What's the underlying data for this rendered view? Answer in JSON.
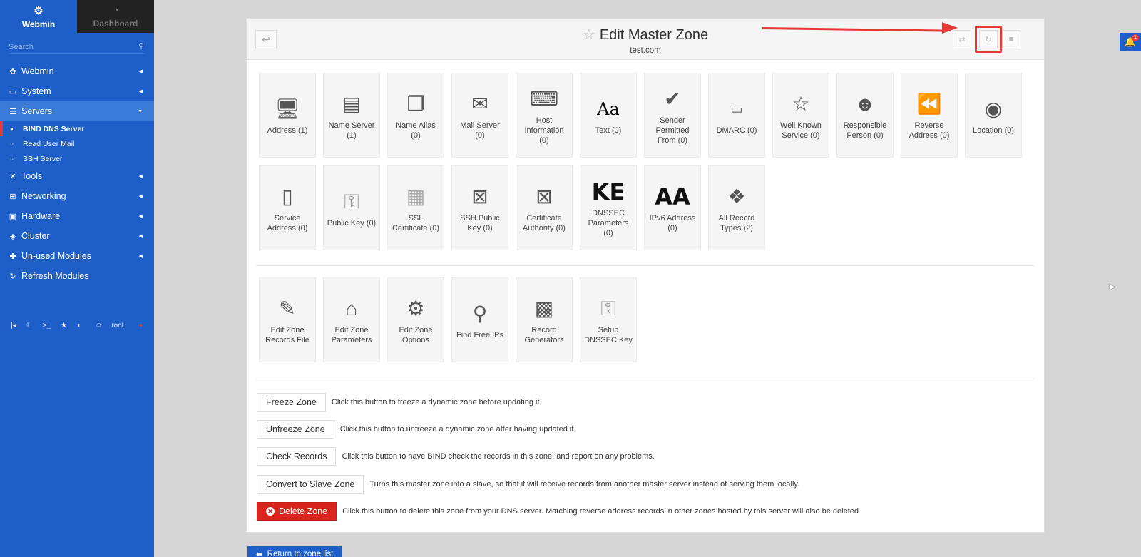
{
  "sidebar": {
    "tab_webmin": "Webmin",
    "tab_dashboard": "Dashboard",
    "search_placeholder": "Search",
    "menu": {
      "webmin": "Webmin",
      "system": "System",
      "servers": "Servers",
      "bind": "BIND DNS Server",
      "readmail": "Read User Mail",
      "ssh": "SSH Server",
      "tools": "Tools",
      "networking": "Networking",
      "hardware": "Hardware",
      "cluster": "Cluster",
      "unused": "Un-used Modules",
      "refresh": "Refresh Modules"
    },
    "user": "root"
  },
  "header": {
    "title": "Edit Master Zone",
    "zone": "test.com"
  },
  "record_types": [
    {
      "label": "Address (1)",
      "icon": "monitor-icon"
    },
    {
      "label": "Name Server (1)",
      "icon": "id-card-icon"
    },
    {
      "label": "Name Alias (0)",
      "icon": "windows-icon"
    },
    {
      "label": "Mail Server (0)",
      "icon": "mailbox-icon"
    },
    {
      "label": "Host Information (0)",
      "icon": "laptop-icon"
    },
    {
      "label": "Text (0)",
      "icon": "text-aa-icon",
      "glyph": "Aa"
    },
    {
      "label": "Sender Permitted From (0)",
      "icon": "envelope-check-icon"
    },
    {
      "label": "DMARC (0)",
      "icon": "dmarc-icon"
    },
    {
      "label": "Well Known Service (0)",
      "icon": "star-icon"
    },
    {
      "label": "Responsible Person (0)",
      "icon": "person-icon"
    },
    {
      "label": "Reverse Address (0)",
      "icon": "rewind-icon"
    },
    {
      "label": "Location (0)",
      "icon": "globe-icon"
    },
    {
      "label": "Service Address (0)",
      "icon": "server-icon"
    },
    {
      "label": "Public Key (0)",
      "icon": "key-icon"
    },
    {
      "label": "SSL Certificate (0)",
      "icon": "certificate-icon"
    },
    {
      "label": "SSH Public Key (0)",
      "icon": "ssh-window-icon"
    },
    {
      "label": "Certificate Authority (0)",
      "icon": "ca-window-icon"
    },
    {
      "label": "DNSSEC Parameters (0)",
      "icon": "ke-icon",
      "glyph": "KE"
    },
    {
      "label": "IPv6 Address (0)",
      "icon": "aa-icon",
      "glyph": "AA"
    },
    {
      "label": "All Record Types (2)",
      "icon": "cubes-icon"
    }
  ],
  "zone_tools": [
    {
      "label": "Edit Zone Records File",
      "icon": "file-edit-icon"
    },
    {
      "label": "Edit Zone Parameters",
      "icon": "lamp-icon"
    },
    {
      "label": "Edit Zone Options",
      "icon": "gear-icon"
    },
    {
      "label": "Find Free IPs",
      "icon": "magnifier-icon"
    },
    {
      "label": "Record Generators",
      "icon": "generator-icon"
    },
    {
      "label": "Setup DNSSEC Key",
      "icon": "key-icon"
    }
  ],
  "actions": [
    {
      "button": "Freeze Zone",
      "desc": "Click this button to freeze a dynamic zone before updating it."
    },
    {
      "button": "Unfreeze Zone",
      "desc": "Click this button to unfreeze a dynamic zone after having updated it."
    },
    {
      "button": "Check Records",
      "desc": "Click this button to have BIND check the records in this zone, and report on any problems."
    },
    {
      "button": "Convert to Slave Zone",
      "desc": "Turns this master zone into a slave, so that it will receive records from another master server instead of serving them locally."
    },
    {
      "button": "Delete Zone",
      "desc": "Click this button to delete this zone from your DNS server. Matching reverse address records in other zones hosted by this server will also be deleted."
    }
  ],
  "return_label": "Return to zone list",
  "notification_count": "1",
  "colors": {
    "sidebar": "#1e5ec8",
    "danger": "#d9231d",
    "highlight": "#e53935"
  }
}
